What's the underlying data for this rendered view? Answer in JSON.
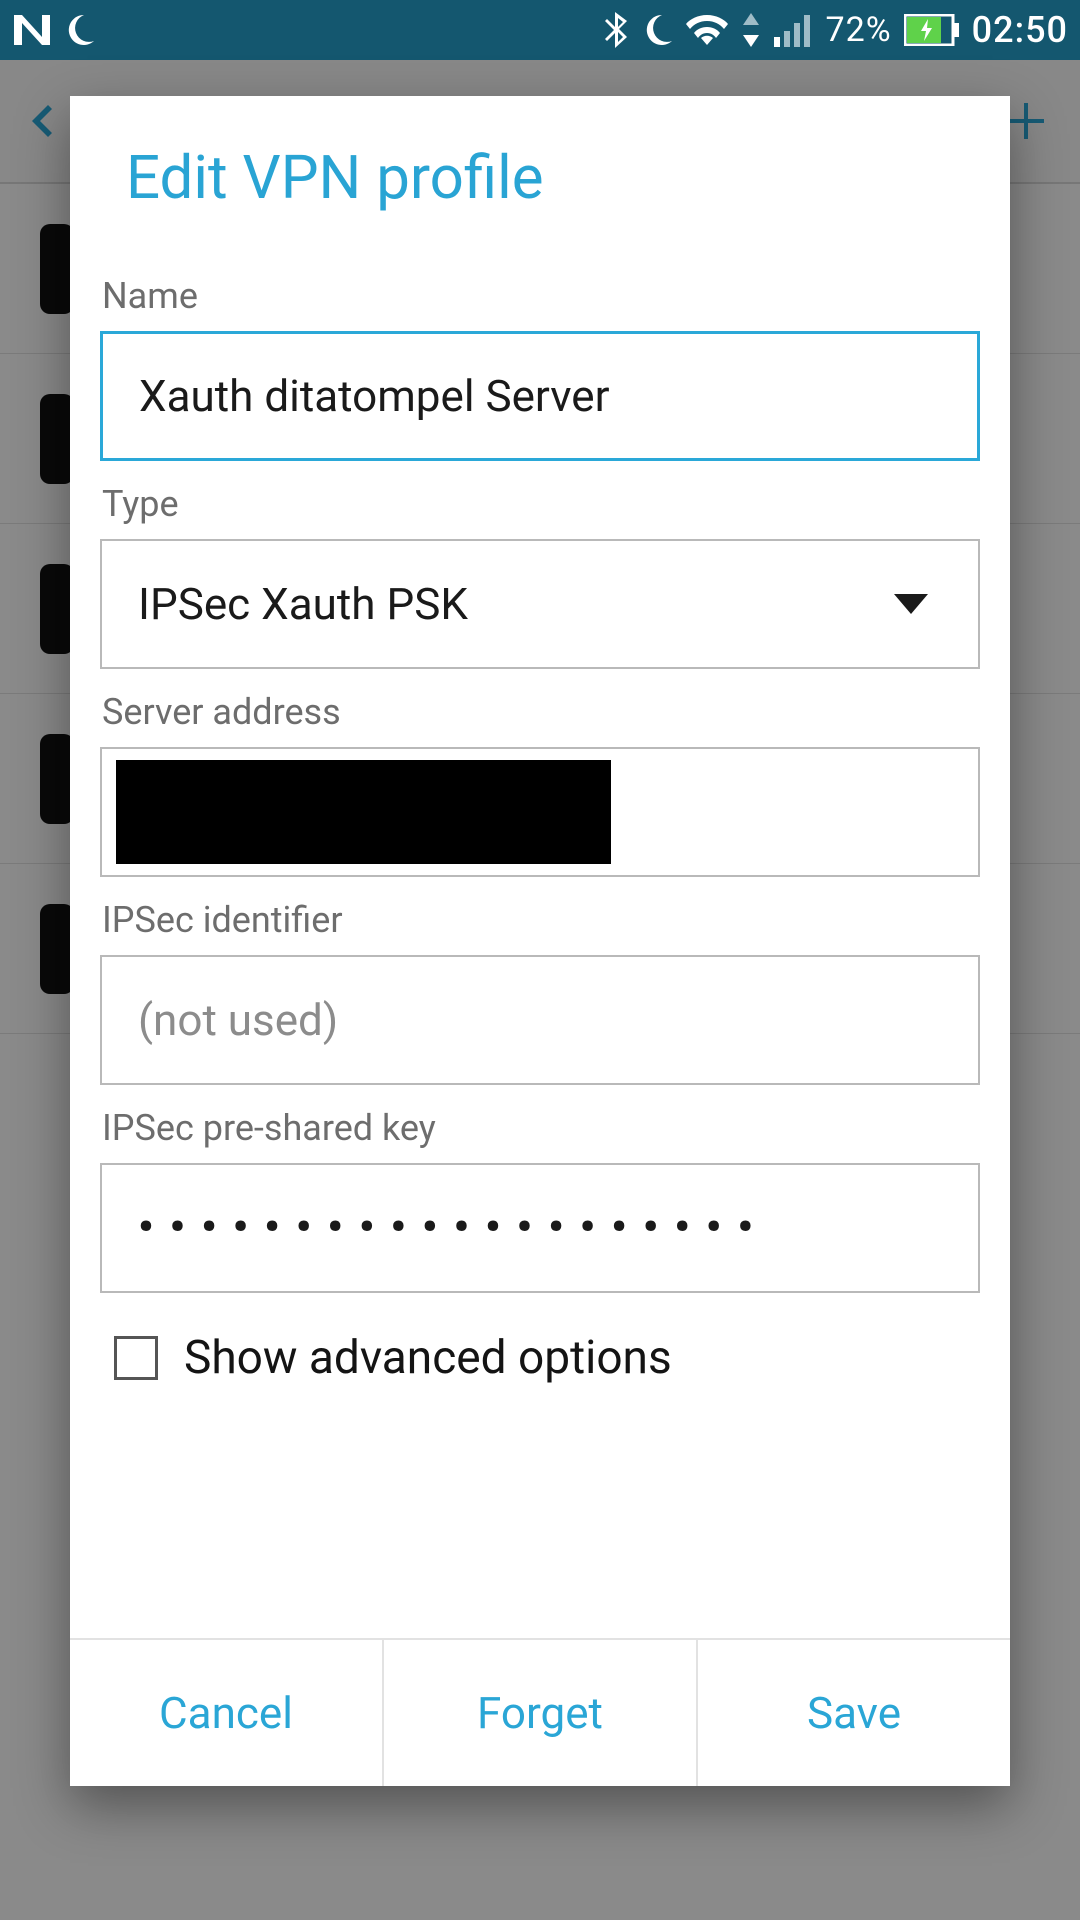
{
  "status_bar": {
    "battery_pct": "72%",
    "clock": "02:50",
    "icons": {
      "n_logo": "N",
      "moon_left": "moon",
      "bluetooth": "bluetooth",
      "moon_right": "moon",
      "wifi": "wifi",
      "sort": "sort",
      "signal": "signal-weak",
      "battery": "battery-charging"
    }
  },
  "dialog": {
    "title": "Edit VPN profile",
    "fields": {
      "name": {
        "label": "Name",
        "value": "Xauth ditatompel Server"
      },
      "type": {
        "label": "Type",
        "value": "IPSec Xauth PSK"
      },
      "server_address": {
        "label": "Server address",
        "value_redacted": true
      },
      "ipsec_identifier": {
        "label": "IPSec identifier",
        "placeholder": "(not used)",
        "value": ""
      },
      "ipsec_psk": {
        "label": "IPSec pre-shared key",
        "masked_value": "••••••••••••••••••••"
      }
    },
    "advanced": {
      "label": "Show advanced options",
      "checked": false
    },
    "actions": {
      "cancel": "Cancel",
      "forget": "Forget",
      "save": "Save"
    }
  },
  "colors": {
    "accent": "#29a4d4",
    "status_bg": "#14576f"
  }
}
